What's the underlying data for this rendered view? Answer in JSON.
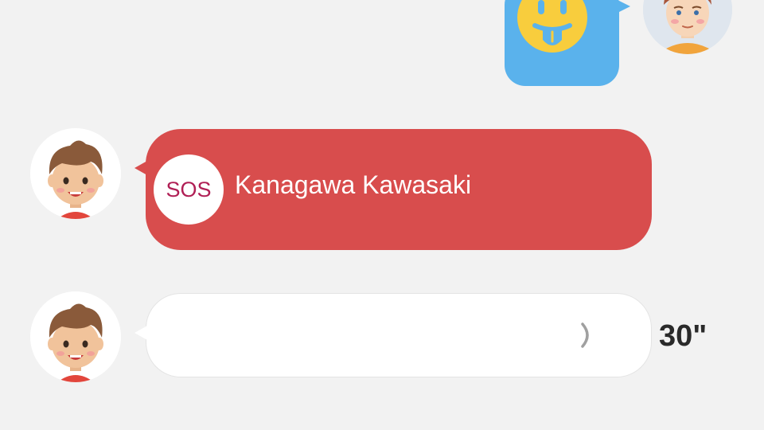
{
  "messages": [
    {
      "kind": "sticker",
      "direction": "outgoing",
      "sticker_icon": "tongue-out-smiley-icon",
      "bubble_color": "#5ab2ec",
      "avatar_icon": "parent-avatar-icon"
    },
    {
      "kind": "sos",
      "direction": "incoming",
      "badge": "SOS",
      "location": "Kanagawa Kawasaki",
      "bubble_color": "#d84d4d",
      "badge_text_color": "#b01f55",
      "avatar_icon": "child-avatar-icon"
    },
    {
      "kind": "voice",
      "direction": "incoming",
      "duration": "30\"",
      "wave_icon": "sound-wave-icon",
      "bubble_color": "#ffffff",
      "avatar_icon": "child-avatar-icon"
    }
  ]
}
